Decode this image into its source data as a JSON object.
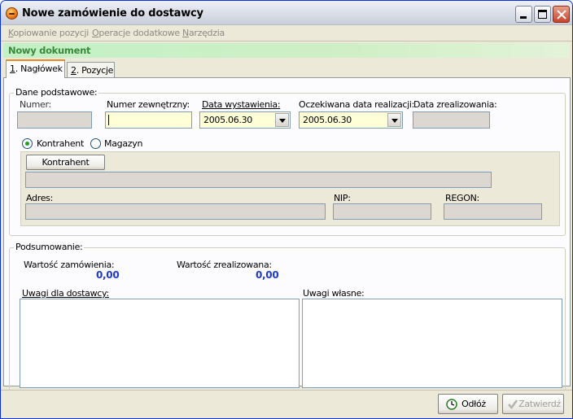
{
  "window": {
    "title": "Nowe zamówienie do dostawcy"
  },
  "menu": {
    "items": [
      {
        "pre": "",
        "u": "K",
        "post": "opiowanie pozycji"
      },
      {
        "pre": "",
        "u": "O",
        "post": "peracje dodatkowe"
      },
      {
        "pre": "",
        "u": "N",
        "post": "arzędzia"
      }
    ]
  },
  "doc_status": "Nowy dokument",
  "tabs": [
    {
      "u": "1",
      "label": ". Nagłówek"
    },
    {
      "u": "2",
      "label": ". Pozycje"
    }
  ],
  "basic": {
    "group_label": "Dane podstawowe:",
    "numer_label": "Numer:",
    "numer_zew_label": "Numer zewnętrzny:",
    "data_wyst_label": "Data wystawienia:",
    "data_wyst_value": "2005.06.30",
    "ocz_data_label": "Oczekiwana data realizacji:",
    "ocz_data_value": "2005.06.30",
    "data_zreal_label": "Data zrealizowania:"
  },
  "party": {
    "kontrahent_radio": "Kontrahent",
    "magazyn_radio": "Magazyn",
    "kontrahent_button": "Kontrahent",
    "adres_label": "Adres:",
    "nip_label": "NIP:",
    "regon_label": "REGON:"
  },
  "summary": {
    "group_label": "Podsumowanie:",
    "wartosc_zam_label": "Wartość zamówienia:",
    "wartosc_zam_value": "0,00",
    "wartosc_zreal_label": "Wartość zrealizowana:",
    "wartosc_zreal_value": "0,00",
    "uwagi_dost_label": "Uwagi dla dostawcy:",
    "uwagi_wlasne_label": "Uwagi własne:"
  },
  "buttons": {
    "odloz": "Odłóż",
    "zatwierdz": "Zatwierdź"
  },
  "colors": {
    "value_blue": "#1f3ac9",
    "status_green": "#3a8a3a",
    "highlight_field": "#ffffd7"
  }
}
